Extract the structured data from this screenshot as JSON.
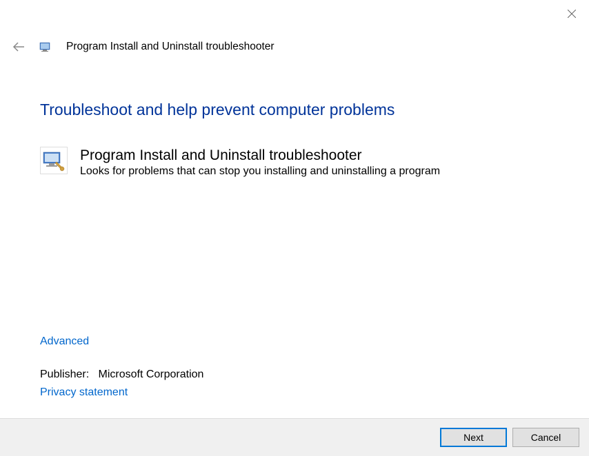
{
  "header": {
    "title": "Program Install and Uninstall troubleshooter"
  },
  "main": {
    "heading": "Troubleshoot and help prevent computer problems",
    "item": {
      "title": "Program Install and Uninstall troubleshooter",
      "description": "Looks for problems that can stop you installing and uninstalling a program"
    },
    "advanced_label": "Advanced",
    "publisher_label": "Publisher:",
    "publisher_value": "Microsoft Corporation",
    "privacy_label": "Privacy statement"
  },
  "footer": {
    "next_label": "Next",
    "cancel_label": "Cancel"
  }
}
